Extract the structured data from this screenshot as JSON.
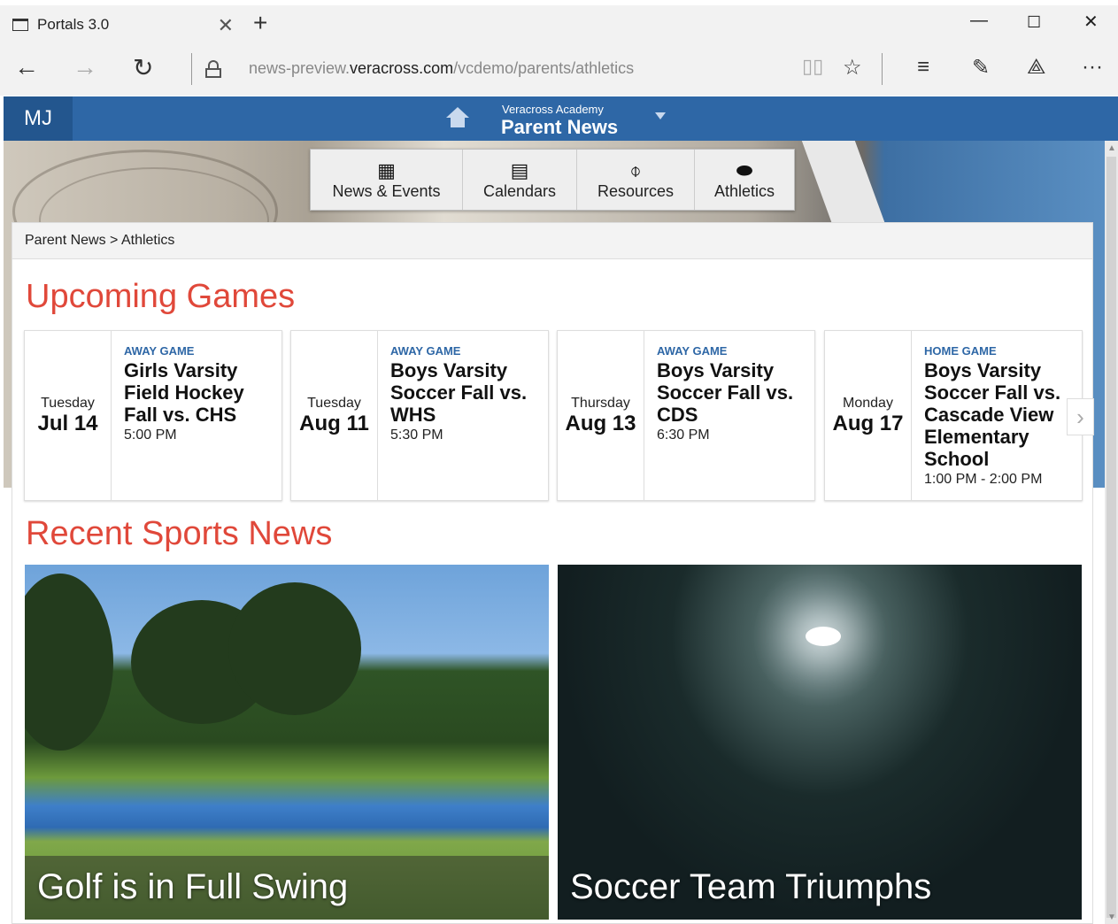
{
  "browser": {
    "tab_title": "Portals 3.0",
    "new_tab": "+",
    "url_prefix": "news-preview.",
    "url_domain": "veracross.com",
    "url_path": "/vcdemo/parents/athletics"
  },
  "header": {
    "initials": "MJ",
    "school": "Veracross Academy",
    "portal": "Parent News"
  },
  "nav": [
    {
      "label": "News & Events",
      "icon": "building-icon"
    },
    {
      "label": "Calendars",
      "icon": "calendar-icon"
    },
    {
      "label": "Resources",
      "icon": "paperclip-icon"
    },
    {
      "label": "Athletics",
      "icon": "football-icon"
    }
  ],
  "breadcrumb": "Parent News > Athletics",
  "upcoming_title": "Upcoming Games",
  "games": [
    {
      "dow": "Tuesday",
      "date": "Jul 14",
      "type": "AWAY GAME",
      "title": "Girls Varsity Field Hockey Fall vs. CHS",
      "time": "5:00 PM"
    },
    {
      "dow": "Tuesday",
      "date": "Aug 11",
      "type": "AWAY GAME",
      "title": "Boys Varsity Soccer Fall vs. WHS",
      "time": "5:30 PM"
    },
    {
      "dow": "Thursday",
      "date": "Aug 13",
      "type": "AWAY GAME",
      "title": "Boys Varsity Soccer Fall vs. CDS",
      "time": "6:30 PM"
    },
    {
      "dow": "Monday",
      "date": "Aug 17",
      "type": "HOME GAME",
      "title": "Boys Varsity Soccer Fall vs. Cascade View Elementary School",
      "time": "1:00 PM - 2:00 PM"
    }
  ],
  "news_title": "Recent Sports News",
  "news": [
    {
      "caption": "Golf is in Full Swing"
    },
    {
      "caption": "Soccer Team Triumphs"
    }
  ],
  "colors": {
    "header_blue": "#2e67a6",
    "accent_red": "#e0483a",
    "game_type_blue": "#2e67a6"
  }
}
